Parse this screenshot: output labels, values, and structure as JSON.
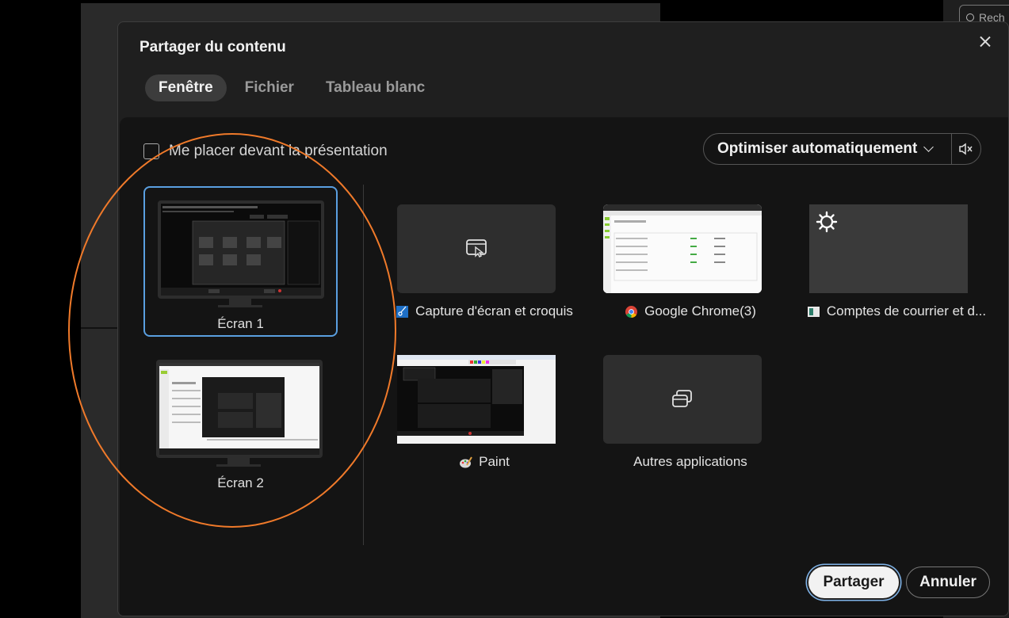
{
  "background": {
    "search_placeholder": "Rech"
  },
  "dialog": {
    "title": "Partager du contenu",
    "tabs": [
      {
        "label": "Fenêtre",
        "active": true
      },
      {
        "label": "Fichier",
        "active": false
      },
      {
        "label": "Tableau blanc",
        "active": false
      }
    ],
    "checkbox_label": "Me placer devant la présentation",
    "checkbox_checked": false,
    "optimize_label": "Optimiser automatiquement",
    "screens": [
      {
        "label": "Écran 1",
        "selected": true
      },
      {
        "label": "Écran 2",
        "selected": false
      }
    ],
    "apps": [
      {
        "label": "Capture d'écran et croquis",
        "icon": "snipping-tool-icon"
      },
      {
        "label": "Google Chrome(3)",
        "icon": "chrome-icon"
      },
      {
        "label": "Comptes de courrier et d...",
        "icon": "mail-accounts-icon"
      },
      {
        "label": "Paint",
        "icon": "paint-icon"
      },
      {
        "label": "Autres applications",
        "icon": "other-apps-icon"
      }
    ],
    "share_button": "Partager",
    "cancel_button": "Annuler"
  },
  "colors": {
    "accent": "#5a9fe0",
    "annotation": "#f07a2a",
    "dialog_bg": "#1f1f1f",
    "panel_bg": "#141414"
  }
}
